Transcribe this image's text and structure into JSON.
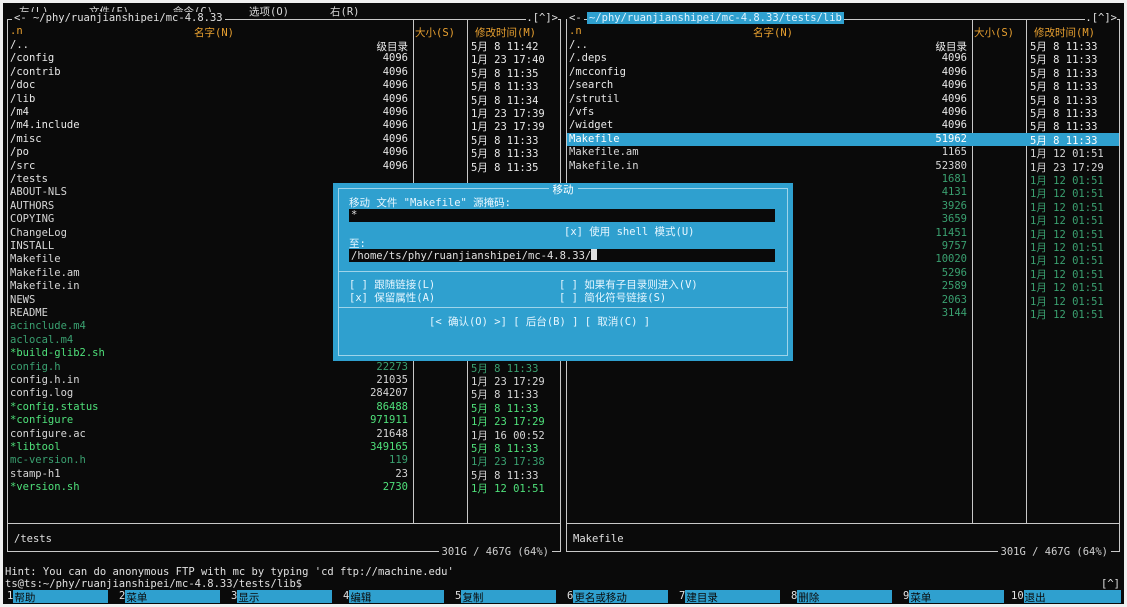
{
  "menu": [
    "左(L)",
    "文件(F)",
    "命令(C)",
    "选项(O)",
    "右(R)"
  ],
  "left_panel": {
    "title": "~/phy/ruanjianshipei/mc-4.8.33",
    "corner": ".[^]>",
    "arrow": "<-",
    "headers": {
      "n": ".n",
      "name": "名字(N)",
      "size": "大小(S)",
      "mtime": "修改时间(M)"
    },
    "rows": [
      {
        "name": "/..",
        "size": "级目录",
        "mtime": "5月  8 11:42",
        "type": "dir"
      },
      {
        "name": "/config",
        "size": "4096",
        "mtime": "1月 23 17:40",
        "type": "dir"
      },
      {
        "name": "/contrib",
        "size": "4096",
        "mtime": "5月  8 11:35",
        "type": "dir"
      },
      {
        "name": "/doc",
        "size": "4096",
        "mtime": "5月  8 11:33",
        "type": "dir"
      },
      {
        "name": "/lib",
        "size": "4096",
        "mtime": "5月  8 11:34",
        "type": "dir"
      },
      {
        "name": "/m4",
        "size": "4096",
        "mtime": "1月 23 17:39",
        "type": "dir"
      },
      {
        "name": "/m4.include",
        "size": "4096",
        "mtime": "1月 23 17:39",
        "type": "dir"
      },
      {
        "name": "/misc",
        "size": "4096",
        "mtime": "5月  8 11:33",
        "type": "dir"
      },
      {
        "name": "/po",
        "size": "4096",
        "mtime": "5月  8 11:33",
        "type": "dir"
      },
      {
        "name": "/src",
        "size": "4096",
        "mtime": "5月  8 11:35",
        "type": "dir"
      },
      {
        "name": "/tests",
        "size": "",
        "mtime": "",
        "type": "dir"
      },
      {
        "name": " ABOUT-NLS",
        "size": "",
        "mtime": "",
        "type": "file"
      },
      {
        "name": " AUTHORS",
        "size": "",
        "mtime": "",
        "type": "file"
      },
      {
        "name": " COPYING",
        "size": "",
        "mtime": "",
        "type": "file"
      },
      {
        "name": " ChangeLog",
        "size": "",
        "mtime": "",
        "type": "file"
      },
      {
        "name": " INSTALL",
        "size": "",
        "mtime": "",
        "type": "file"
      },
      {
        "name": " Makefile",
        "size": "",
        "mtime": "",
        "type": "file"
      },
      {
        "name": " Makefile.am",
        "size": "",
        "mtime": "",
        "type": "file"
      },
      {
        "name": " Makefile.in",
        "size": "",
        "mtime": "",
        "type": "file"
      },
      {
        "name": " NEWS",
        "size": "",
        "mtime": "",
        "type": "file"
      },
      {
        "name": " README",
        "size": "",
        "mtime": "",
        "type": "file"
      },
      {
        "name": " acinclude.m4",
        "size": "",
        "mtime": "",
        "type": "grn"
      },
      {
        "name": " aclocal.m4",
        "size": "",
        "mtime": "",
        "type": "grn"
      },
      {
        "name": "*build-glib2.sh",
        "size": "",
        "mtime": "",
        "type": "exe"
      },
      {
        "name": " config.h",
        "size": "22273",
        "mtime": "5月  8 11:33",
        "type": "grn"
      },
      {
        "name": " config.h.in",
        "size": "21035",
        "mtime": "1月 23 17:29",
        "type": "file"
      },
      {
        "name": " config.log",
        "size": "284207",
        "mtime": "5月  8 11:33",
        "type": "file"
      },
      {
        "name": "*config.status",
        "size": "86488",
        "mtime": "5月  8 11:33",
        "type": "exe"
      },
      {
        "name": "*configure",
        "size": "971911",
        "mtime": "1月 23 17:29",
        "type": "exe"
      },
      {
        "name": " configure.ac",
        "size": "21648",
        "mtime": "1月 16 00:52",
        "type": "file"
      },
      {
        "name": "*libtool",
        "size": "349165",
        "mtime": "5月  8 11:33",
        "type": "exe"
      },
      {
        "name": " mc-version.h",
        "size": "119",
        "mtime": "1月 23 17:38",
        "type": "grn"
      },
      {
        "name": " stamp-h1",
        "size": "23",
        "mtime": "5月  8 11:33",
        "type": "file"
      },
      {
        "name": "*version.sh",
        "size": "2730",
        "mtime": "1月 12 01:51",
        "type": "exe"
      }
    ],
    "mini_status": "/tests",
    "free": "301G / 467G (64%)"
  },
  "right_panel": {
    "title": "~/phy/ruanjianshipei/mc-4.8.33/tests/lib",
    "corner": ".[^]>",
    "arrow": "<-",
    "headers": {
      "n": ".n",
      "name": "名字(N)",
      "size": "大小(S)",
      "mtime": "修改时间(M)"
    },
    "rows": [
      {
        "name": "/..",
        "size": "级目录",
        "mtime": "5月  8 11:33",
        "type": "dir"
      },
      {
        "name": "/.deps",
        "size": "4096",
        "mtime": "5月  8 11:33",
        "type": "dir"
      },
      {
        "name": "/mcconfig",
        "size": "4096",
        "mtime": "5月  8 11:33",
        "type": "dir"
      },
      {
        "name": "/search",
        "size": "4096",
        "mtime": "5月  8 11:33",
        "type": "dir"
      },
      {
        "name": "/strutil",
        "size": "4096",
        "mtime": "5月  8 11:33",
        "type": "dir"
      },
      {
        "name": "/vfs",
        "size": "4096",
        "mtime": "5月  8 11:33",
        "type": "dir"
      },
      {
        "name": "/widget",
        "size": "4096",
        "mtime": "5月  8 11:33",
        "type": "dir"
      },
      {
        "name": " Makefile",
        "size": "51962",
        "mtime": "5月  8 11:33",
        "type": "sel"
      },
      {
        "name": " Makefile.am",
        "size": "1165",
        "mtime": "1月 12 01:51",
        "type": "file"
      },
      {
        "name": " Makefile.in",
        "size": "52380",
        "mtime": "1月 23 17:29",
        "type": "file"
      },
      {
        "name": "",
        "size": "1681",
        "mtime": "1月 12 01:51",
        "type": "grn"
      },
      {
        "name": "",
        "size": "4131",
        "mtime": "1月 12 01:51",
        "type": "grn"
      },
      {
        "name": "",
        "size": "3926",
        "mtime": "1月 12 01:51",
        "type": "grn"
      },
      {
        "name": "",
        "size": "3659",
        "mtime": "1月 12 01:51",
        "type": "grn"
      },
      {
        "name": "",
        "size": "11451",
        "mtime": "1月 12 01:51",
        "type": "grn"
      },
      {
        "name": "c",
        "size": "9757",
        "mtime": "1月 12 01:51",
        "type": "grn"
      },
      {
        "name": "",
        "size": "10020",
        "mtime": "1月 12 01:51",
        "type": "grn"
      },
      {
        "name": "",
        "size": "5296",
        "mtime": "1月 12 01:51",
        "type": "grn"
      },
      {
        "name": "hell.c",
        "size": "2589",
        "mtime": "1月 12 01:51",
        "type": "grn"
      },
      {
        "name": "",
        "size": "2063",
        "mtime": "1月 12 01:51",
        "type": "grn"
      },
      {
        "name": "",
        "size": "3144",
        "mtime": "1月 12 01:51",
        "type": "grn"
      }
    ],
    "mini_status": "Makefile",
    "free": "301G / 467G (64%)"
  },
  "dialog": {
    "title": "移动",
    "source_label": "移动 文件 \"Makefile\" 源掩码:",
    "source_value": "*",
    "shell_patterns": "[x] 使用 shell 模式(U)",
    "to_label": "至:",
    "to_value": "/home/ts/phy/ruanjianshipei/mc-4.8.33/",
    "opt_follow": "[ ] 跟随链接(L)",
    "opt_preserve": "[x] 保留属性(A)",
    "opt_dive": "[ ] 如果有子目录则进入(V)",
    "opt_stable": "[ ] 简化符号链接(S)",
    "buttons": "[< 确认(O) >] [ 后台(B) ] [ 取消(C) ]"
  },
  "hint": "Hint: You can do anonymous FTP with mc by typing 'cd ftp://machine.edu'",
  "prompt": "ts@ts:~/phy/ruanjianshipei/mc-4.8.33/tests/lib$",
  "prompt_corner": "[^]",
  "fkeys": [
    {
      "num": "1",
      "label": "帮助"
    },
    {
      "num": "2",
      "label": "菜单"
    },
    {
      "num": "3",
      "label": "显示"
    },
    {
      "num": "4",
      "label": "编辑"
    },
    {
      "num": "5",
      "label": "复制"
    },
    {
      "num": "6",
      "label": "更名或移动"
    },
    {
      "num": "7",
      "label": "建目录"
    },
    {
      "num": "8",
      "label": "删除"
    },
    {
      "num": "9",
      "label": "菜单"
    },
    {
      "num": "10",
      "label": "退出"
    }
  ],
  "colors": {
    "accent": "#2fa0cf",
    "header": "#e8a030",
    "exe": "#4fe07a",
    "bg": "#0a0a0a"
  }
}
